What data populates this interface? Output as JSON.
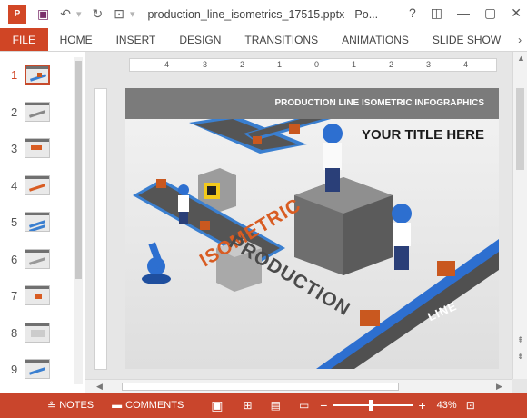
{
  "window": {
    "title": "production_line_isometrics_17515.pptx - Po...",
    "controls": [
      "?",
      "◫",
      "—",
      "▢",
      "✕"
    ]
  },
  "ribbon": {
    "file": "FILE",
    "tabs": [
      "HOME",
      "INSERT",
      "DESIGN",
      "TRANSITIONS",
      "ANIMATIONS",
      "SLIDE SHOW"
    ]
  },
  "thumbnails": {
    "active": 1,
    "numbers": [
      "1",
      "2",
      "3",
      "4",
      "5",
      "6",
      "7",
      "8",
      "9"
    ]
  },
  "ruler": {
    "ticks": [
      "4",
      "3",
      "2",
      "1",
      "0",
      "1",
      "2",
      "3",
      "4"
    ]
  },
  "slide": {
    "header": "PRODUCTION LINE ISOMETRIC INFOGRAPHICS",
    "title": "YOUR TITLE HERE",
    "word_isometric": "ISOMETRIC",
    "word_production": "PRODUCTION",
    "word_line": "LINE"
  },
  "status": {
    "notes": "NOTES",
    "comments": "COMMENTS",
    "zoom": "43%"
  },
  "colors": {
    "accent": "#d04525",
    "belt": "#3a7fd0",
    "box": "#c9581f"
  }
}
